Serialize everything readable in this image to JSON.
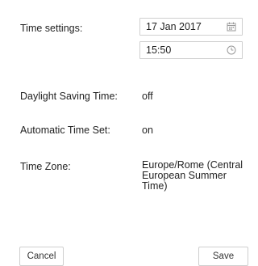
{
  "time_settings": {
    "label": "Time settings:",
    "date_value": "17 Jan 2017",
    "time_value": "15:50",
    "date_icon": "calendar-icon",
    "time_icon": "clock-icon"
  },
  "daylight_saving": {
    "label": "Daylight Saving Time:",
    "value": "off"
  },
  "automatic_time": {
    "label": "Automatic Time Set:",
    "value": "on"
  },
  "time_zone": {
    "label": "Time Zone:",
    "value_lines": [
      "Europe/Rome (Central",
      "European Summer",
      "Time)"
    ]
  },
  "buttons": {
    "cancel": "Cancel",
    "save": "Save"
  },
  "colors": {
    "border": "#cfcfcf",
    "icon": "#999999",
    "text": "#222222"
  }
}
